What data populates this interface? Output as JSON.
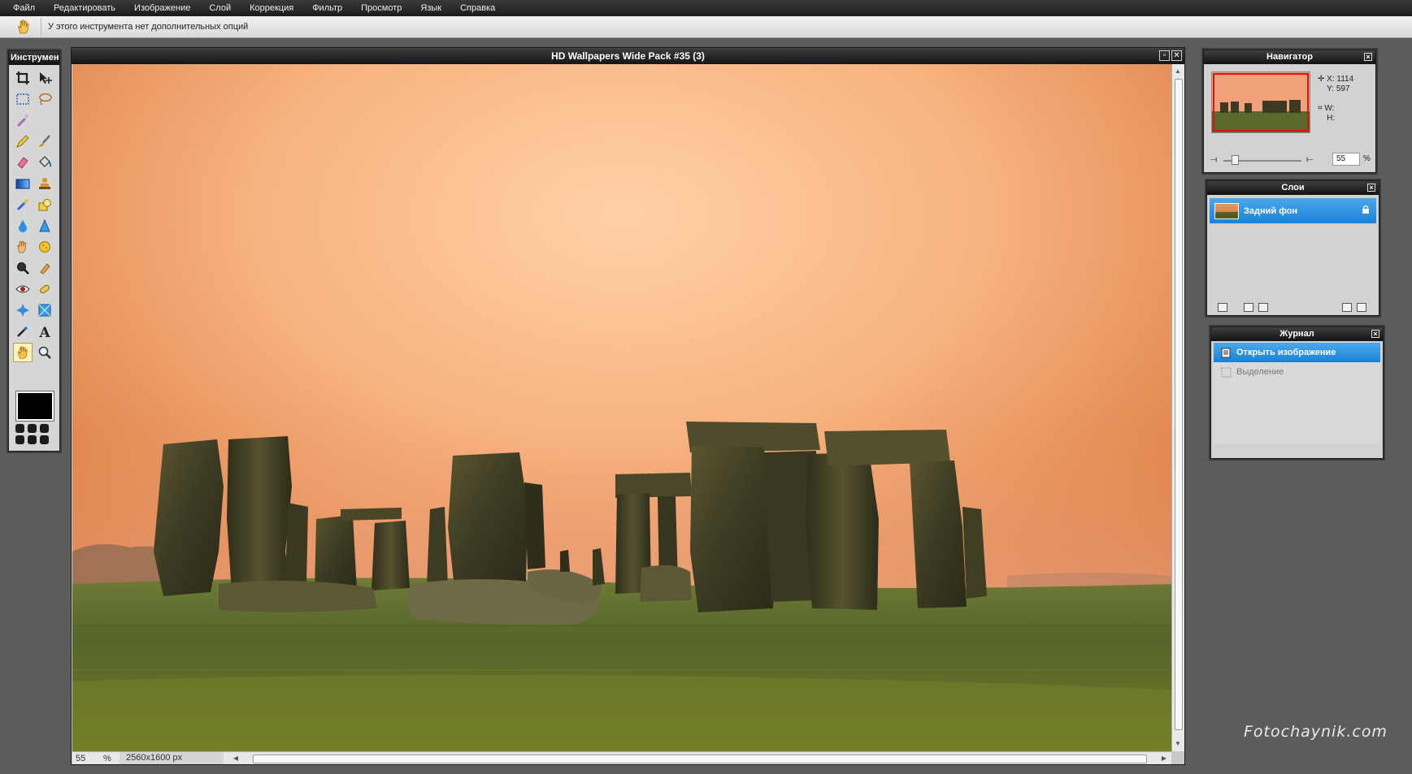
{
  "menu": [
    "Файл",
    "Редактировать",
    "Изображение",
    "Слой",
    "Коррекция",
    "Фильтр",
    "Просмотр",
    "Язык",
    "Справка"
  ],
  "options_bar": {
    "message": "У этого инструмента нет дополнительных опций"
  },
  "tools_panel": {
    "title": "Инструмент",
    "tools": [
      "crop-icon",
      "move-icon",
      "marquee-icon",
      "lasso-icon",
      "magic-wand-icon",
      "pencil-icon",
      "brush-icon",
      "eraser-icon",
      "bucket-icon",
      "gradient-icon",
      "clone-stamp-icon",
      "color-replace-icon",
      "shape-icon",
      "blur-icon",
      "sharpen-icon",
      "smudge-icon",
      "sponge-icon",
      "dodge-icon",
      "burn-icon",
      "red-eye-icon",
      "spot-heal-icon",
      "bloat-icon",
      "pinch-icon",
      "color-picker-icon",
      "type-icon",
      "hand-icon",
      "zoom-icon"
    ],
    "active_tool": "hand-icon",
    "foreground_color": "#000000"
  },
  "image_window": {
    "title": "HD Wallpapers Wide Pack #35 (3)",
    "zoom": "55",
    "zoom_unit": "%",
    "dimensions": "2560x1600 px"
  },
  "navigator": {
    "title": "Навигатор",
    "x_label": "X:",
    "x_value": "1114",
    "y_label": "Y:",
    "y_value": "597",
    "w_label": "W:",
    "h_label": "H:",
    "zoom_value": "55",
    "zoom_unit": "%"
  },
  "layers": {
    "title": "Слои",
    "items": [
      {
        "label": "Задний фон",
        "locked": true
      }
    ]
  },
  "history": {
    "title": "Журнал",
    "items": [
      {
        "label": "Открыть изображение",
        "selected": true
      },
      {
        "label": "Выделение",
        "selected": false
      }
    ]
  },
  "watermark": "Fotochaynik.com",
  "colors": {
    "accent": "#2290e0",
    "sky_center": "#ffc9a0",
    "sky_edge": "#d9753e",
    "grass": "#5a6a25"
  }
}
